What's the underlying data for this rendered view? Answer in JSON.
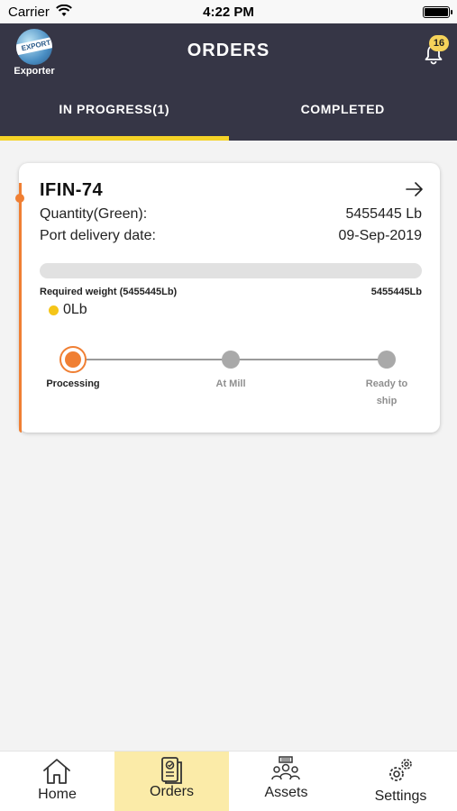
{
  "status_bar": {
    "carrier": "Carrier",
    "time": "4:22 PM"
  },
  "header": {
    "logo_text": "EXPORT",
    "logo_caption": "Exporter",
    "title": "ORDERS",
    "notification_count": "16"
  },
  "tabs": [
    {
      "label": "IN PROGRESS(1)",
      "active": true
    },
    {
      "label": "COMPLETED",
      "active": false
    }
  ],
  "order": {
    "id": "IFIN-74",
    "quantity_label": "Quantity(Green):",
    "quantity_value": "5455445 Lb",
    "delivery_label": "Port delivery date:",
    "delivery_value": "09-Sep-2019",
    "required_weight_label": "Required weight (5455445Lb)",
    "required_weight_value": "5455445Lb",
    "current_weight": "0Lb",
    "progress_fraction": 0,
    "steps": [
      {
        "label": "Processing",
        "state": "active"
      },
      {
        "label": "At Mill",
        "state": "pending"
      },
      {
        "label": "Ready to ship",
        "state": "pending"
      }
    ]
  },
  "bottom_nav": [
    {
      "label": "Home",
      "icon": "home-icon",
      "active": false
    },
    {
      "label": "Orders",
      "icon": "orders-icon",
      "active": true
    },
    {
      "label": "Assets",
      "icon": "assets-icon",
      "active": false
    },
    {
      "label": "Settings",
      "icon": "settings-icon",
      "active": false
    }
  ],
  "colors": {
    "header_bg": "#363646",
    "accent_yellow": "#f5d327",
    "accent_orange": "#f07f33",
    "active_nav_bg": "#fbeba8"
  }
}
